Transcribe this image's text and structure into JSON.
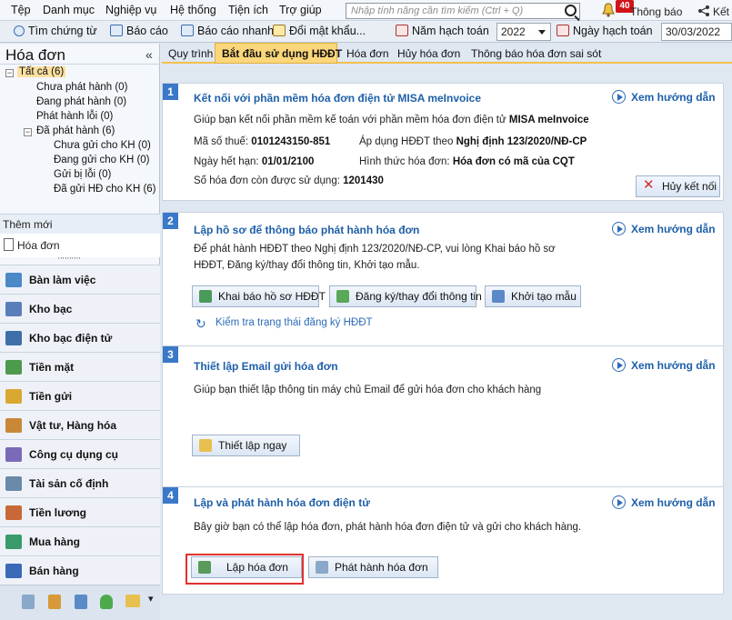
{
  "menu": {
    "items": [
      "Tệp",
      "Danh mục",
      "Nghiệp vụ",
      "Hệ thống",
      "Tiện ích",
      "Trợ giúp"
    ],
    "search_placeholder": "Nhập tính năng cần tìm kiếm (Ctrl + Q)",
    "notif_count": "40",
    "notif_label": "Thông báo",
    "connect_label": "Kết"
  },
  "toolbar": {
    "find_voucher": "Tìm chứng từ",
    "report": "Báo cáo",
    "quick_report": "Báo cáo nhanh",
    "change_password": "Đổi mật khẩu...",
    "fiscal_year_label": "Năm hạch toán",
    "fiscal_year_value": "2022",
    "posting_date_label": "Ngày hạch toán",
    "posting_date_value": "30/03/2022"
  },
  "left": {
    "title": "Hóa đơn",
    "collapse": "«",
    "tree": [
      {
        "label": "Tất cả (6)"
      },
      {
        "label": "Chưa phát hành (0)"
      },
      {
        "label": "Đang phát hành (0)"
      },
      {
        "label": "Phát hành lỗi (0)"
      },
      {
        "label": "Đã phát hành (6)"
      },
      {
        "label": "Chưa gửi cho KH (0)"
      },
      {
        "label": "Đang gửi cho KH (0)"
      },
      {
        "label": "Gửi bị lỗi (0)"
      },
      {
        "label": "Đã gửi HĐ cho KH (6)"
      }
    ],
    "new_label": "Thêm mới",
    "new_item": "Hóa đơn",
    "nav": [
      "Bàn làm việc",
      "Kho bạc",
      "Kho bạc điện tử",
      "Tiền mặt",
      "Tiền gửi",
      "Vật tư, Hàng hóa",
      "Công cụ dụng cụ",
      "Tài sản cố định",
      "Tiền lương",
      "Mua hàng",
      "Bán hàng"
    ]
  },
  "tabs": [
    "Quy trình",
    "Bắt đầu sử dụng HĐĐT",
    "Hóa đơn",
    "Hủy hóa đơn",
    "Thông báo hóa đơn sai sót"
  ],
  "guide_label": "Xem hướng dẫn",
  "step1": {
    "num": "1",
    "title": "Kết nối với phần mềm hóa đơn điện tử MISA meInvoice",
    "desc_pre": "Giúp bạn kết nối phần mềm kế toán với phần mềm hóa đơn điện tử ",
    "desc_brand": "MISA meInvoice",
    "tax_label": "Mã số thuế:",
    "tax_value": "0101243150-851",
    "expiry_label": "Ngày hết hạn:",
    "expiry_value": "01/01/2100",
    "remaining_label": "Số hóa đơn còn được sử dụng:",
    "remaining_value": "1201430",
    "apply_label": "Áp dụng HĐĐT theo",
    "apply_value": "Nghị định 123/2020/NĐ-CP",
    "form_label": "Hình thức hóa đơn:",
    "form_value": "Hóa đơn có mã của CQT",
    "disconnect": "Hủy kết nối"
  },
  "step2": {
    "num": "2",
    "title": "Lập hồ sơ để thông báo phát hành hóa đơn",
    "desc1": "Để phát hành HĐĐT theo Nghị định 123/2020/NĐ-CP, vui lòng Khai báo hồ sơ",
    "desc2": "HĐĐT, Đăng ký/thay đổi thông tin, Khởi tạo mẫu.",
    "btn_declare": "Khai báo hồ sơ HĐĐT",
    "btn_register": "Đăng ký/thay đổi thông tin",
    "btn_template": "Khởi tạo mẫu",
    "check_status": "Kiểm tra trạng thái đăng ký HĐĐT"
  },
  "step3": {
    "num": "3",
    "title": "Thiết lập Email gửi hóa đơn",
    "desc": "Giúp bạn thiết lập thông tin máy chủ Email để gửi hóa đơn cho khách hàng",
    "btn_setup": "Thiết lập ngay"
  },
  "step4": {
    "num": "4",
    "title": "Lập và phát hành hóa đơn điện tử",
    "desc": "Bây giờ bạn có thể lập hóa đơn, phát hành hóa đơn điện tử và gửi cho khách hàng.",
    "btn_create": "Lập hóa đơn",
    "btn_issue": "Phát hành hóa đơn"
  }
}
